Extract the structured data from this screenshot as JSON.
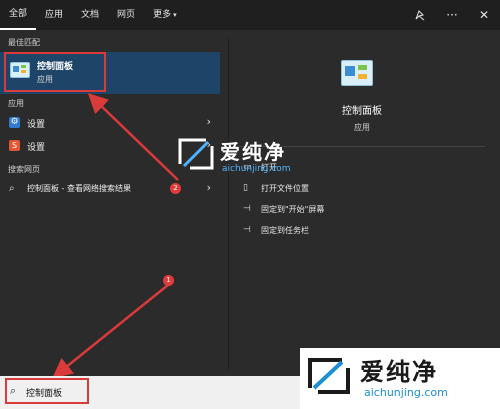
{
  "topbar": {
    "tabs": [
      "全部",
      "应用",
      "文档",
      "网页",
      "更多"
    ],
    "more_caret": "▾",
    "icons": [
      "feedback-icon",
      "more-icon",
      "close-icon"
    ]
  },
  "left": {
    "best_label": "最佳匹配",
    "best": {
      "title": "控制面板",
      "sub": "应用"
    },
    "apps_label": "应用",
    "apps": [
      {
        "label": "设置",
        "icon": "gear-icon"
      },
      {
        "label": "设置",
        "icon": "shield-icon"
      }
    ],
    "web_label": "搜索网页",
    "web": {
      "label": "控制面板 - 查看网络搜索结果",
      "icon": "search-icon"
    }
  },
  "right": {
    "title": "控制面板",
    "sub": "应用",
    "actions": [
      {
        "label": "打开",
        "icon": "open-icon"
      },
      {
        "label": "打开文件位置",
        "icon": "folder-icon"
      },
      {
        "label": "固定到\"开始\"屏幕",
        "icon": "pin-icon"
      },
      {
        "label": "固定到任务栏",
        "icon": "pin-icon"
      }
    ]
  },
  "search": {
    "value": "控制面板",
    "icon": "search-icon"
  },
  "badges": [
    "1",
    "2"
  ],
  "watermark": {
    "cn": "爱纯净",
    "url": "aichunjing.com"
  },
  "colors": {
    "highlight": "#1e4568",
    "annotation": "#d93a3a",
    "accent": "#1a8fd6"
  }
}
